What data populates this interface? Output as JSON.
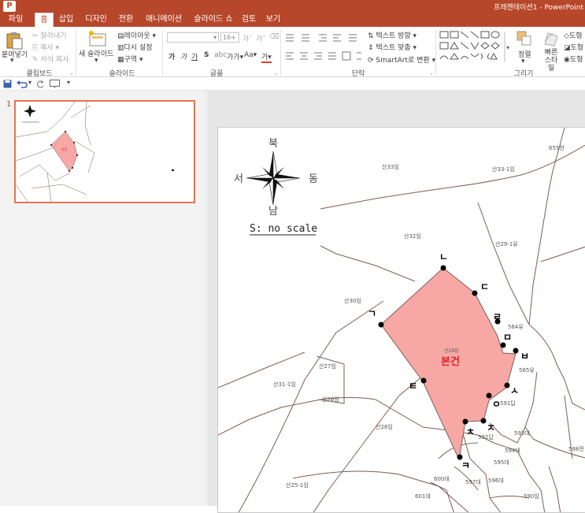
{
  "window": {
    "app_icon": "P",
    "title": "프레젠테이션1 - PowerPoint"
  },
  "tabs": [
    {
      "label": "파일"
    },
    {
      "label": "홈"
    },
    {
      "label": "삽입"
    },
    {
      "label": "디자인"
    },
    {
      "label": "전환"
    },
    {
      "label": "애니메이션"
    },
    {
      "label": "슬라이드 쇼"
    },
    {
      "label": "검토"
    },
    {
      "label": "보기"
    }
  ],
  "ribbon": {
    "clipboard": {
      "paste": "붙여넣기",
      "cut": "잘라내기",
      "copy": "복사",
      "format_painter": "서식 복사",
      "label": "클립보드"
    },
    "slides": {
      "new_slide": "새 슬라이드",
      "layout": "레이아웃",
      "reset": "다시 설정",
      "section": "구역",
      "label": "슬라이드"
    },
    "font": {
      "size": "16+",
      "label": "글꼴",
      "b": "가",
      "i": "가",
      "u": "가",
      "s": "S",
      "spacing": "가가",
      "case": "Aa",
      "color": "가"
    },
    "paragraph": {
      "text_direction": "텍스트 방향",
      "align_text": "텍스트 맞춤",
      "smartart": "SmartArt로 변환",
      "label": "단락"
    },
    "drawing": {
      "arrange": "정렬",
      "quick_styles": "빠른 스타일",
      "fill": "도형",
      "outline": "도형",
      "effects": "도형",
      "label": "그리기"
    }
  },
  "qat": {
    "customize": "▾"
  },
  "thumbnails": [
    {
      "number": "1"
    }
  ],
  "slide": {
    "compass": {
      "north": "북",
      "south": "남",
      "west": "서",
      "east": "동"
    },
    "scale": "S: no scale",
    "parcels": [
      "산33임",
      "산33-1임",
      "산32임",
      "산29-1유",
      "산30임",
      "564유",
      "565유",
      "산27임",
      "산31-1임",
      "591답",
      "산26임",
      "592답",
      "593대",
      "산28임",
      "594대",
      "595대",
      "596대",
      "597대",
      "600대",
      "601대",
      "산25-1임",
      "588전",
      "590임",
      "655전"
    ],
    "subject_parcel": "산29임",
    "subject_label": "본건",
    "points": [
      "ㄱ",
      "ㄴ",
      "ㄷ",
      "ㄹ",
      "ㅁ",
      "ㅂ",
      "ㅅ",
      "ㅇ",
      "ㅈ",
      "ㅊ",
      "ㅋ",
      "ㅌ"
    ]
  },
  "colors": {
    "accent": "#b7472a",
    "thumb_border": "#e8734f",
    "parcel_fill": "#f7a8a5",
    "subject_text": "#e5201f"
  }
}
